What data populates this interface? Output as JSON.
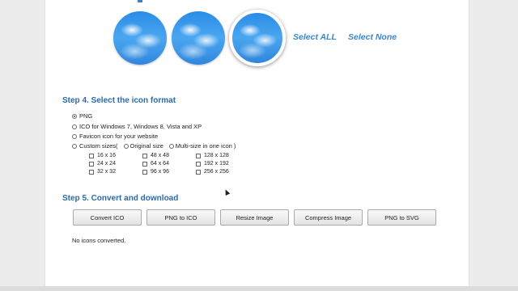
{
  "icons": {
    "select_all": "Select ALL",
    "select_none": "Select None"
  },
  "step4": {
    "title": "Step 4. Select the icon format",
    "options": {
      "png": "PNG",
      "ico": "ICO for Windows 7, Windows 8, Vista and XP",
      "favicon": "Favicon icon for your website",
      "custom": "Custom sizes(",
      "original": "Original size",
      "multi": "Multi-size in one icon )"
    },
    "selected": "PNG",
    "sizes": [
      "16 x 16",
      "48 x 48",
      "128 x 128",
      "24 x 24",
      "64 x 64",
      "192 x 192",
      "32 x 32",
      "96 x 96",
      "256 x 256"
    ]
  },
  "step5": {
    "title": "Step 5. Convert and download",
    "buttons": [
      "Convert ICO",
      "PNG to ICO",
      "Resize Image",
      "Compress Image",
      "PNG to SVG"
    ],
    "status": "No icons converted."
  },
  "colors": {
    "accent": "#2a6aa8",
    "link": "#3a86c8",
    "circle": "#2a8ce6"
  }
}
